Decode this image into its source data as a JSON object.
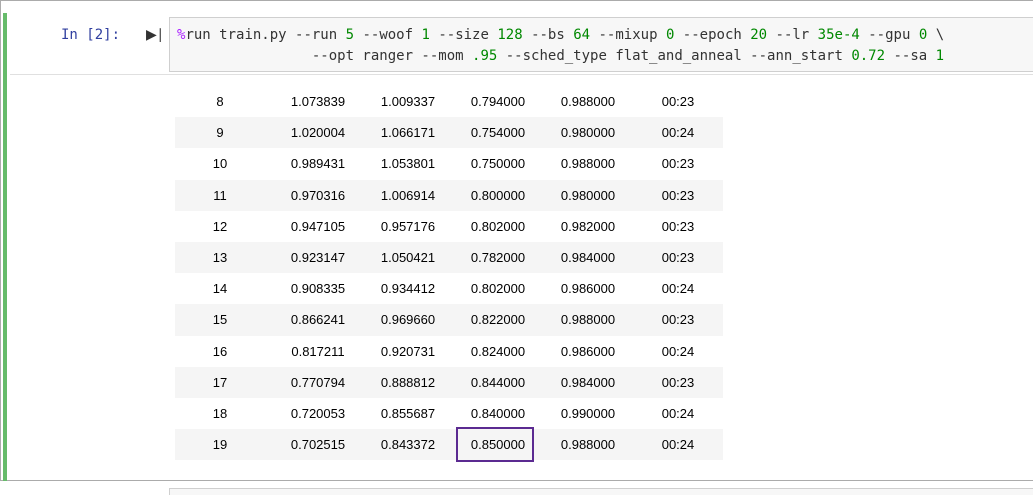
{
  "cell": {
    "prompt": "In [2]:",
    "code_lines": [
      [
        {
          "t": "magic",
          "v": "%"
        },
        {
          "t": "plain",
          "v": "run train.py --run "
        },
        {
          "t": "num",
          "v": "5"
        },
        {
          "t": "plain",
          "v": " --woof "
        },
        {
          "t": "num",
          "v": "1"
        },
        {
          "t": "plain",
          "v": " --size "
        },
        {
          "t": "num",
          "v": "128"
        },
        {
          "t": "plain",
          "v": " --bs "
        },
        {
          "t": "num",
          "v": "64"
        },
        {
          "t": "plain",
          "v": " --mixup "
        },
        {
          "t": "num",
          "v": "0"
        },
        {
          "t": "plain",
          "v": " --epoch "
        },
        {
          "t": "num",
          "v": "20"
        },
        {
          "t": "plain",
          "v": " --lr "
        },
        {
          "t": "num",
          "v": "35e-4"
        },
        {
          "t": "plain",
          "v": " --gpu "
        },
        {
          "t": "num",
          "v": "0"
        },
        {
          "t": "plain",
          "v": " \\"
        }
      ],
      [
        {
          "t": "plain",
          "v": "                --opt ranger --mom "
        },
        {
          "t": "num",
          "v": ".95"
        },
        {
          "t": "plain",
          "v": " --sched_type flat_and_anneal --ann_start "
        },
        {
          "t": "num",
          "v": "0.72"
        },
        {
          "t": "plain",
          "v": " --sa "
        },
        {
          "t": "num",
          "v": "1"
        }
      ]
    ]
  },
  "results": {
    "rows": [
      [
        "8",
        "1.073839",
        "1.009337",
        "0.794000",
        "0.988000",
        "00:23"
      ],
      [
        "9",
        "1.020004",
        "1.066171",
        "0.754000",
        "0.980000",
        "00:24"
      ],
      [
        "10",
        "0.989431",
        "1.053801",
        "0.750000",
        "0.988000",
        "00:23"
      ],
      [
        "11",
        "0.970316",
        "1.006914",
        "0.800000",
        "0.980000",
        "00:23"
      ],
      [
        "12",
        "0.947105",
        "0.957176",
        "0.802000",
        "0.982000",
        "00:23"
      ],
      [
        "13",
        "0.923147",
        "1.050421",
        "0.782000",
        "0.984000",
        "00:23"
      ],
      [
        "14",
        "0.908335",
        "0.934412",
        "0.802000",
        "0.986000",
        "00:24"
      ],
      [
        "15",
        "0.866241",
        "0.969660",
        "0.822000",
        "0.988000",
        "00:23"
      ],
      [
        "16",
        "0.817211",
        "0.920731",
        "0.824000",
        "0.986000",
        "00:24"
      ],
      [
        "17",
        "0.770794",
        "0.888812",
        "0.844000",
        "0.984000",
        "00:23"
      ],
      [
        "18",
        "0.720053",
        "0.855687",
        "0.840000",
        "0.990000",
        "00:24"
      ],
      [
        "19",
        "0.702515",
        "0.843372",
        "0.850000",
        "0.988000",
        "00:24"
      ]
    ]
  },
  "colors": {
    "cell_accent": "#66bb6a",
    "highlight": "#5b2a91",
    "prompt": "#303f9f"
  },
  "icons": {
    "run": "run-cell-icon"
  }
}
